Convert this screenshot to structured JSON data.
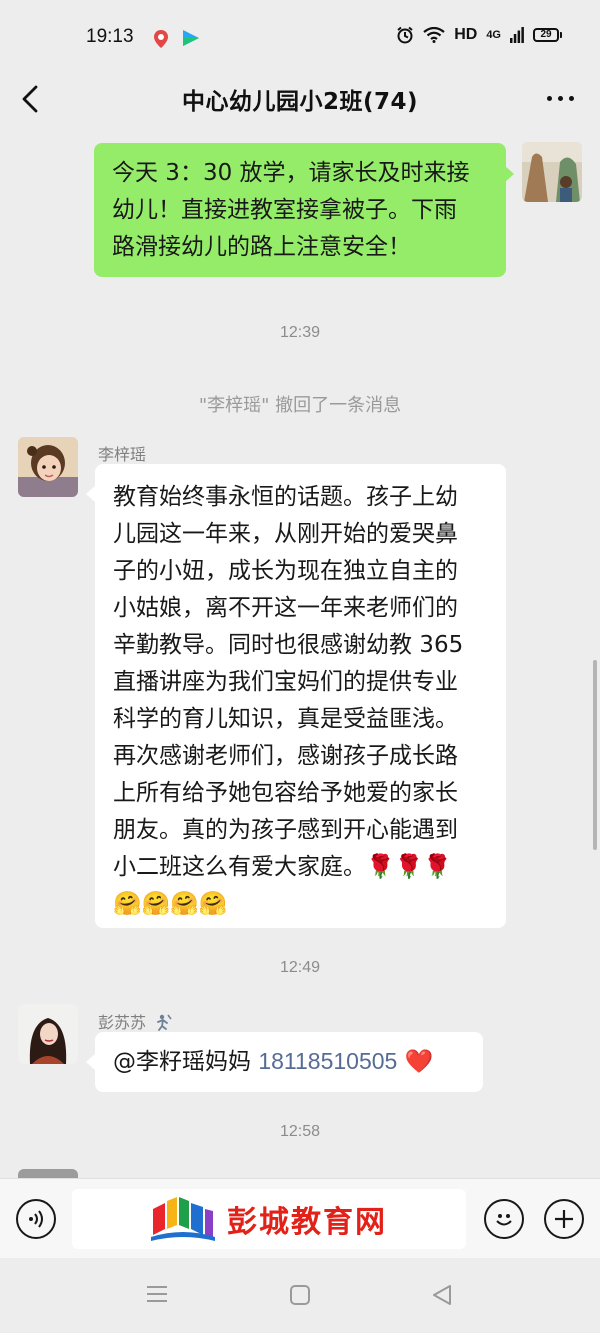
{
  "status_bar": {
    "time": "19:13",
    "network": "HD",
    "signal": "4G",
    "battery": "29"
  },
  "header": {
    "title": "中心幼儿园小2班(74)"
  },
  "messages": {
    "m1": {
      "lines": [
        "今天 3：30 放学，请家长及时来接",
        "幼儿！直接进教室接拿被子。下雨",
        "路滑接幼儿的路上注意安全！"
      ]
    },
    "time1": "12:39",
    "recall": "\"李梓瑶\" 撤回了一条消息",
    "m2": {
      "sender": "李梓瑶",
      "lines": [
        "教育始终事永恒的话题。孩子上幼",
        "儿园这一年来，从刚开始的爱哭鼻",
        "子的小妞，成长为现在独立自主的",
        "小姑娘，离不开这一年来老师们的",
        "辛勤教导。同时也很感谢幼教 365",
        "直播讲座为我们宝妈们的提供专业",
        "科学的育儿知识，真是受益匪浅。",
        "再次感谢老师们，感谢孩子成长路",
        "上所有给予她包容给予她爱的家长",
        "朋友。真的为孩子感到开心能遇到",
        "小二班这么有爱大家庭。🌹🌹🌹"
      ],
      "emoji_line": "🤗🤗🤗🤗"
    },
    "time2": "12:49",
    "m3": {
      "sender": "彭苏苏",
      "mention": "@李籽瑶妈妈",
      "phone": "18118510505",
      "emoji": "❤️"
    },
    "time3": "12:58"
  },
  "input_bar": {
    "brand": "彭城教育网"
  },
  "colors": {
    "bubble_self": "#95ec69",
    "bubble_other": "#ffffff",
    "background": "#ededed",
    "link": "#576b95",
    "brand": "#e22219"
  }
}
